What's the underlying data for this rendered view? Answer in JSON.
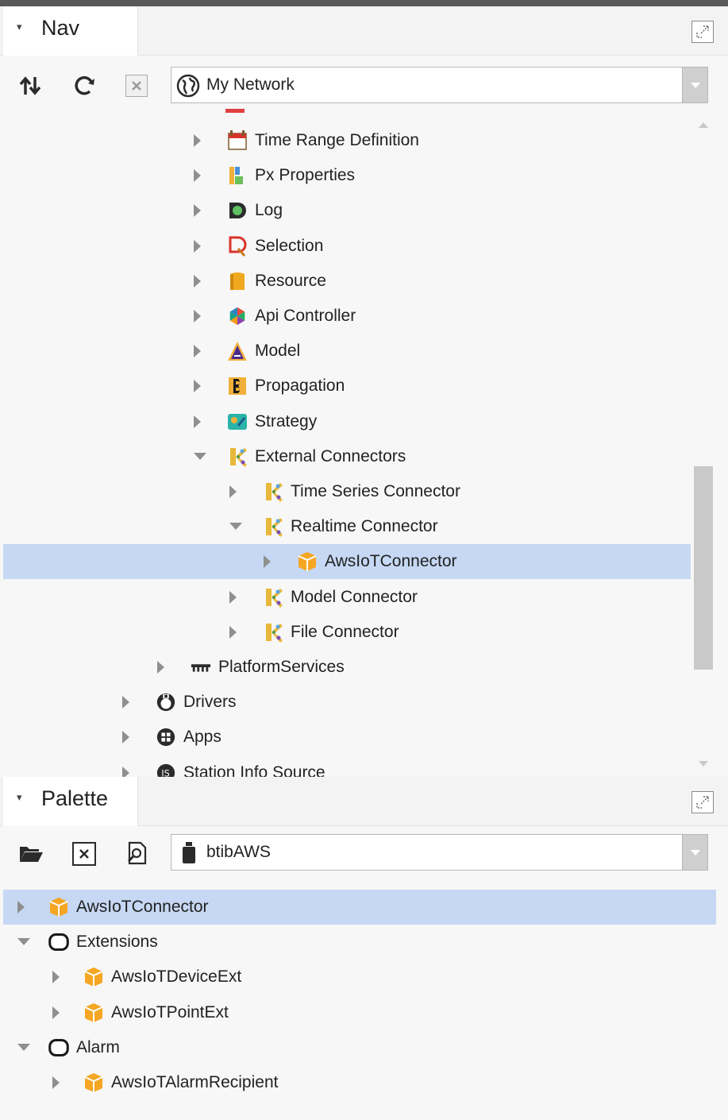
{
  "nav": {
    "title": "Nav",
    "location": "My Network",
    "tree": [
      {
        "id": "time-range-definition",
        "label": "Time Range Definition",
        "icon": "calendar-icon",
        "state": "collapsed",
        "level": 3
      },
      {
        "id": "px-properties",
        "label": "Px Properties",
        "icon": "px-properties-icon",
        "state": "collapsed",
        "level": 3
      },
      {
        "id": "log",
        "label": "Log",
        "icon": "log-icon",
        "state": "collapsed",
        "level": 3
      },
      {
        "id": "selection",
        "label": "Selection",
        "icon": "selection-icon",
        "state": "collapsed",
        "level": 3
      },
      {
        "id": "resource",
        "label": "Resource",
        "icon": "resource-icon",
        "state": "collapsed",
        "level": 3
      },
      {
        "id": "api-controller",
        "label": "Api Controller",
        "icon": "api-controller-icon",
        "state": "collapsed",
        "level": 3
      },
      {
        "id": "model",
        "label": "Model",
        "icon": "model-icon",
        "state": "collapsed",
        "level": 3
      },
      {
        "id": "propagation",
        "label": "Propagation",
        "icon": "propagation-icon",
        "state": "collapsed",
        "level": 3
      },
      {
        "id": "strategy",
        "label": "Strategy",
        "icon": "strategy-icon",
        "state": "collapsed",
        "level": 3
      },
      {
        "id": "external-connectors",
        "label": "External Connectors",
        "icon": "connector-icon",
        "state": "expanded",
        "level": 3
      },
      {
        "id": "time-series-connector",
        "label": "Time Series Connector",
        "icon": "connector-icon",
        "state": "collapsed",
        "level": 4
      },
      {
        "id": "realtime-connector",
        "label": "Realtime Connector",
        "icon": "connector-icon",
        "state": "expanded",
        "level": 4
      },
      {
        "id": "aws-iot-connector",
        "label": "AwsIoTConnector",
        "icon": "cube-icon",
        "state": "collapsed",
        "level": 5,
        "selected": true
      },
      {
        "id": "model-connector",
        "label": "Model Connector",
        "icon": "connector-icon",
        "state": "collapsed",
        "level": 4
      },
      {
        "id": "file-connector",
        "label": "File Connector",
        "icon": "connector-icon",
        "state": "collapsed",
        "level": 4
      },
      {
        "id": "platform-services",
        "label": "PlatformServices",
        "icon": "platform-services-icon",
        "state": "collapsed",
        "level": 2
      },
      {
        "id": "drivers",
        "label": "Drivers",
        "icon": "drivers-icon",
        "state": "collapsed",
        "level": 1
      },
      {
        "id": "apps",
        "label": "Apps",
        "icon": "apps-icon",
        "state": "collapsed",
        "level": 1
      },
      {
        "id": "station-info-source",
        "label": "Station Info Source",
        "icon": "station-info-icon",
        "state": "collapsed",
        "level": 1
      }
    ]
  },
  "palette": {
    "title": "Palette",
    "module": "btibAWS",
    "tree": [
      {
        "id": "pal-aws-iot-connector",
        "label": "AwsIoTConnector",
        "icon": "cube-icon",
        "state": "collapsed",
        "level": 0,
        "selected": true
      },
      {
        "id": "extensions",
        "label": "Extensions",
        "icon": "folder-ring-icon",
        "state": "expanded",
        "level": 0
      },
      {
        "id": "aws-iot-device-ext",
        "label": "AwsIoTDeviceExt",
        "icon": "cube-icon",
        "state": "collapsed",
        "level": 1
      },
      {
        "id": "aws-iot-point-ext",
        "label": "AwsIoTPointExt",
        "icon": "cube-icon",
        "state": "collapsed",
        "level": 1
      },
      {
        "id": "alarm",
        "label": "Alarm",
        "icon": "folder-ring-icon",
        "state": "expanded",
        "level": 0
      },
      {
        "id": "aws-iot-alarm-recipient",
        "label": "AwsIoTAlarmRecipient",
        "icon": "cube-icon",
        "state": "collapsed",
        "level": 1
      }
    ]
  },
  "colors": {
    "selection": "#c6d8f3",
    "cube": "#f5a623",
    "connector": "#e8b83a",
    "expander": "#8f8f8f"
  }
}
